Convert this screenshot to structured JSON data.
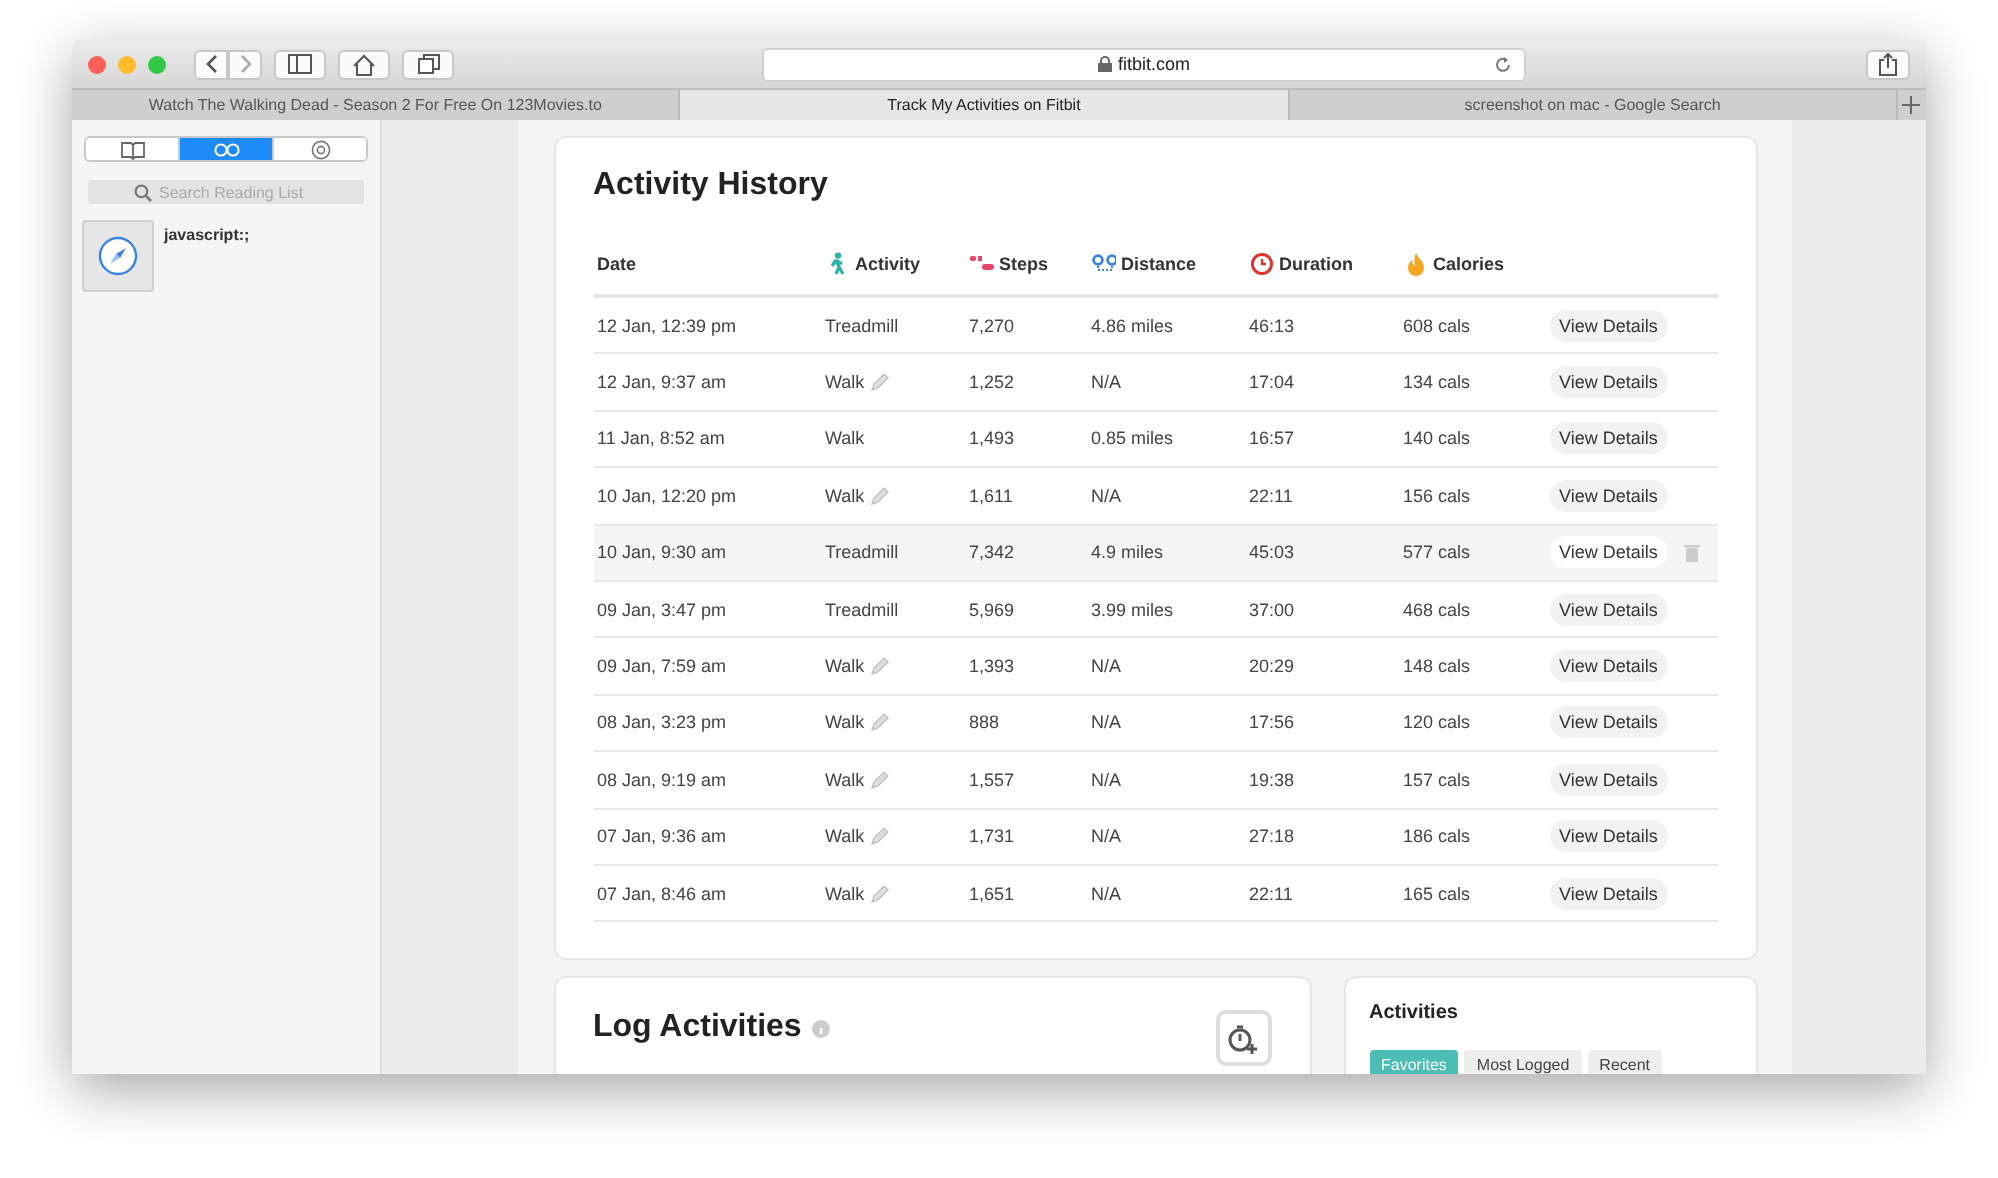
{
  "browser": {
    "address": "fitbit.com",
    "tabs": [
      {
        "label": "Watch The Walking Dead - Season 2 For Free On 123Movies.to",
        "selected": false
      },
      {
        "label": "Track My Activities on Fitbit",
        "selected": true
      },
      {
        "label": "screenshot on mac - Google Search",
        "selected": false
      }
    ]
  },
  "sidebar": {
    "segments": [
      {
        "kind": "book",
        "selected": false
      },
      {
        "kind": "glasses",
        "selected": true
      },
      {
        "kind": "at",
        "selected": false
      }
    ],
    "search": {
      "placeholder": "Search Reading List"
    },
    "items": [
      {
        "title": "javascript:;"
      }
    ]
  },
  "activity_history": {
    "title": "Activity History",
    "columns": [
      {
        "kind": "date",
        "label": "Date"
      },
      {
        "kind": "activity",
        "label": "Activity"
      },
      {
        "kind": "steps",
        "label": "Steps"
      },
      {
        "kind": "distance",
        "label": "Distance"
      },
      {
        "kind": "duration",
        "label": "Duration"
      },
      {
        "kind": "calories",
        "label": "Calories"
      }
    ],
    "rows": [
      {
        "date": "12 Jan, 12:39 pm",
        "activity": "Treadmill",
        "editable": false,
        "steps": "7,270",
        "distance": "4.86 miles",
        "duration": "46:13",
        "calories": "608 cals",
        "button": "View Details",
        "highlighted": false
      },
      {
        "date": "12 Jan, 9:37 am",
        "activity": "Walk",
        "editable": true,
        "steps": "1,252",
        "distance": "N/A",
        "duration": "17:04",
        "calories": "134 cals",
        "button": "View Details",
        "highlighted": false
      },
      {
        "date": "11 Jan, 8:52 am",
        "activity": "Walk",
        "editable": false,
        "steps": "1,493",
        "distance": "0.85 miles",
        "duration": "16:57",
        "calories": "140 cals",
        "button": "View Details",
        "highlighted": false
      },
      {
        "date": "10 Jan, 12:20 pm",
        "activity": "Walk",
        "editable": true,
        "steps": "1,611",
        "distance": "N/A",
        "duration": "22:11",
        "calories": "156 cals",
        "button": "View Details",
        "highlighted": false
      },
      {
        "date": "10 Jan, 9:30 am",
        "activity": "Treadmill",
        "editable": false,
        "steps": "7,342",
        "distance": "4.9 miles",
        "duration": "45:03",
        "calories": "577 cals",
        "button": "View Details",
        "highlighted": true
      },
      {
        "date": "09 Jan, 3:47 pm",
        "activity": "Treadmill",
        "editable": false,
        "steps": "5,969",
        "distance": "3.99 miles",
        "duration": "37:00",
        "calories": "468 cals",
        "button": "View Details",
        "highlighted": false
      },
      {
        "date": "09 Jan, 7:59 am",
        "activity": "Walk",
        "editable": true,
        "steps": "1,393",
        "distance": "N/A",
        "duration": "20:29",
        "calories": "148 cals",
        "button": "View Details",
        "highlighted": false
      },
      {
        "date": "08 Jan, 3:23 pm",
        "activity": "Walk",
        "editable": true,
        "steps": "888",
        "distance": "N/A",
        "duration": "17:56",
        "calories": "120 cals",
        "button": "View Details",
        "highlighted": false
      },
      {
        "date": "08 Jan, 9:19 am",
        "activity": "Walk",
        "editable": true,
        "steps": "1,557",
        "distance": "N/A",
        "duration": "19:38",
        "calories": "157 cals",
        "button": "View Details",
        "highlighted": false
      },
      {
        "date": "07 Jan, 9:36 am",
        "activity": "Walk",
        "editable": true,
        "steps": "1,731",
        "distance": "N/A",
        "duration": "27:18",
        "calories": "186 cals",
        "button": "View Details",
        "highlighted": false
      },
      {
        "date": "07 Jan, 8:46 am",
        "activity": "Walk",
        "editable": true,
        "steps": "1,651",
        "distance": "N/A",
        "duration": "22:11",
        "calories": "165 cals",
        "button": "View Details",
        "highlighted": false
      }
    ]
  },
  "log_activities": {
    "title": "Log Activities"
  },
  "activities_panel": {
    "title": "Activities",
    "tabs": [
      {
        "label": "Favorites",
        "selected": true
      },
      {
        "label": "Most Logged",
        "selected": false
      },
      {
        "label": "Recent",
        "selected": false
      }
    ]
  }
}
